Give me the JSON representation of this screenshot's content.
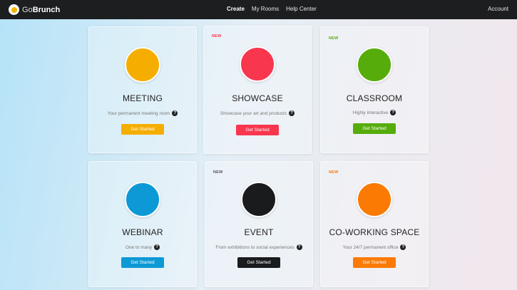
{
  "brand": {
    "name_light": "Go",
    "name_bold": "Brunch",
    "accent": "#f4b400"
  },
  "nav": [
    {
      "label": "Create",
      "active": true
    },
    {
      "label": "My Rooms",
      "active": false
    },
    {
      "label": "Help Center",
      "active": false
    }
  ],
  "account_label": "Account",
  "cards": [
    {
      "badge": "",
      "title": "MEETING",
      "desc": "Your permanent meeting room",
      "button": "Get Started",
      "color": "#f5ae00",
      "badge_color": ""
    },
    {
      "badge": "NEW",
      "title": "SHOWCASE",
      "desc": "Showcase your art and products",
      "button": "Get Started",
      "color": "#f8364e",
      "badge_color": "#f8364e"
    },
    {
      "badge": "NEW",
      "title": "CLASSROOM",
      "desc": "Highly interactive",
      "button": "Get Started",
      "color": "#56ac0a",
      "badge_color": "#56ac0a"
    },
    {
      "badge": "",
      "title": "WEBINAR",
      "desc": "One to many",
      "button": "Get Started",
      "color": "#0c99d6",
      "badge_color": ""
    },
    {
      "badge": "NEW",
      "title": "EVENT",
      "desc": "From exhibitions to social experiences",
      "button": "Get Started",
      "color": "#191b1c",
      "badge_color": "#555555"
    },
    {
      "badge": "NEW",
      "title": "CO-WORKING SPACE",
      "desc": "Your 24/7 permanent office",
      "button": "Get Started",
      "color": "#fb7a04",
      "badge_color": "#fb7a04"
    }
  ]
}
